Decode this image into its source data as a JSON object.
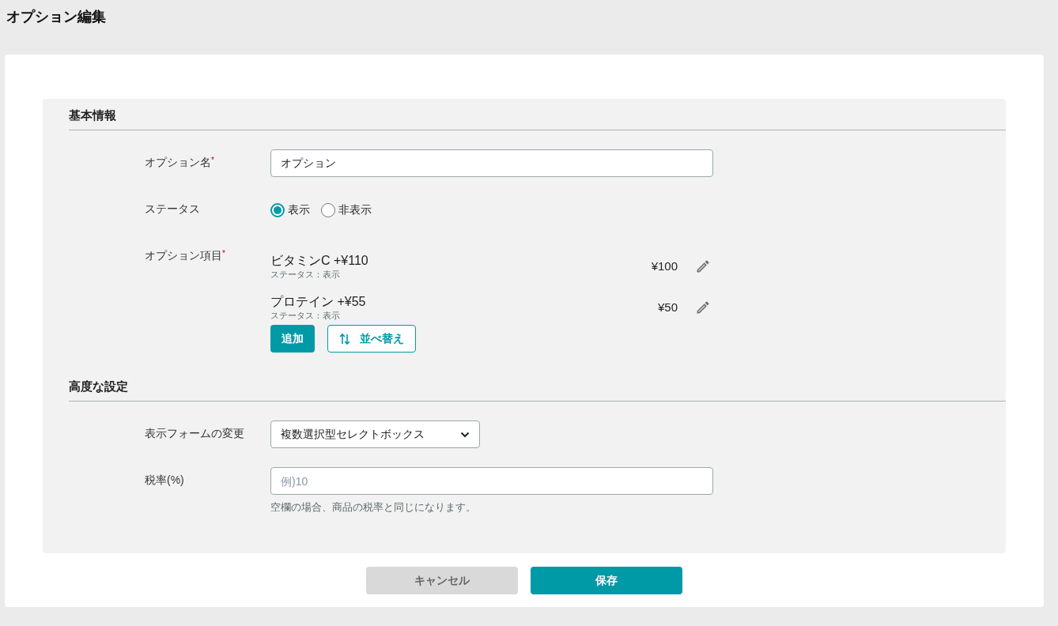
{
  "page_title": "オプション編集",
  "sections": [
    {
      "title": "基本情報",
      "fields": [
        {
          "kind": "text",
          "label": "オプション名",
          "required_mark": "*",
          "value": "オプション"
        },
        {
          "kind": "radio",
          "label": "ステータス",
          "options": [
            {
              "label": "表示",
              "selected": true
            },
            {
              "label": "非表示",
              "selected": false
            }
          ]
        },
        {
          "kind": "items",
          "label": "オプション項目",
          "required_mark": "*",
          "items": [
            {
              "name": "ビタミンC +¥110",
              "status": "ステータス：表示",
              "price": "¥100"
            },
            {
              "name": "プロテイン +¥55",
              "status": "ステータス：表示",
              "price": "¥50"
            }
          ],
          "buttons": [
            {
              "label": "追加",
              "kind": "primary"
            },
            {
              "label": "並べ替え",
              "kind": "sort"
            }
          ]
        }
      ]
    },
    {
      "title": "高度な設定",
      "fields": [
        {
          "kind": "select",
          "label": "表示フォームの変更",
          "value": "複数選択型セレクトボックス"
        },
        {
          "kind": "input",
          "label": "税率(%)",
          "placeholder": "例)10",
          "help": "空欄の場合、商品の税率と同じになります。"
        }
      ]
    }
  ],
  "footer_buttons": [
    {
      "label": "キャンセル",
      "kind": "secondary"
    },
    {
      "label": "保存",
      "kind": "primary"
    }
  ]
}
